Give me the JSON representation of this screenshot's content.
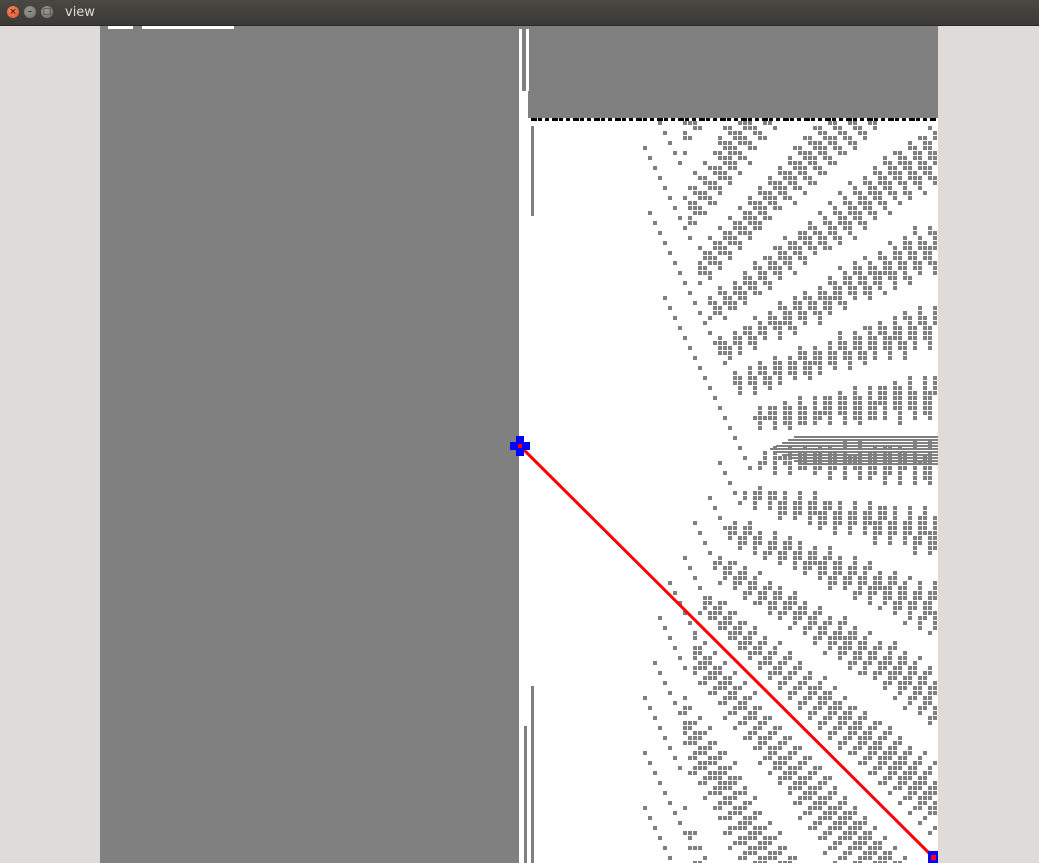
{
  "window": {
    "title": "view"
  },
  "controls": {
    "close_glyph": "×",
    "minimize_glyph": "–",
    "maximize_glyph": "□"
  },
  "colors": {
    "window_bg": "#dedbd8",
    "unknown": "#808080",
    "free": "#ffffff",
    "obstacle": "#000000",
    "path": "#ff0000",
    "marker": "#0000ff"
  },
  "icons": {
    "start": "cross-marker-icon",
    "goal": "cross-marker-icon"
  }
}
